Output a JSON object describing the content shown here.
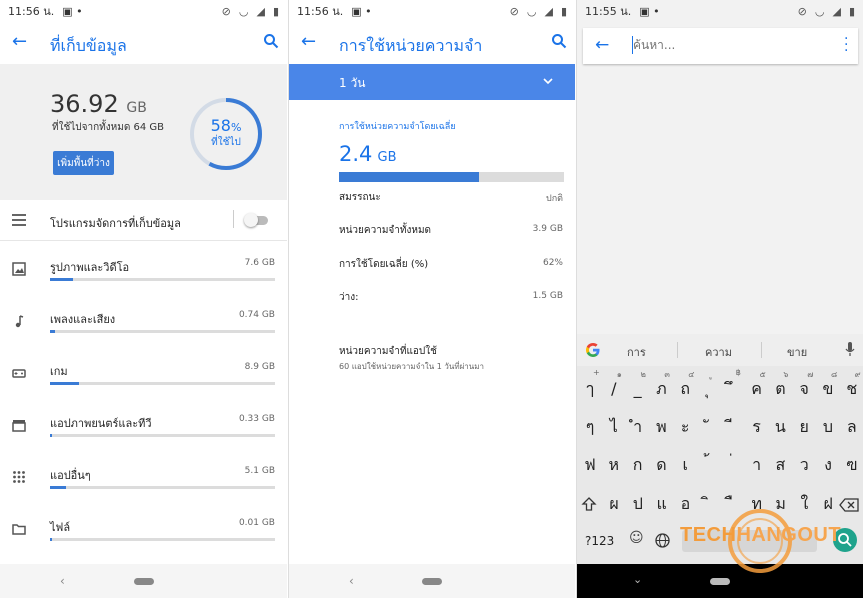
{
  "status_bar": {
    "p1_time": "11:56 น.",
    "p2_time": "11:56 น.",
    "p3_time": "11:55 น."
  },
  "storage": {
    "title": "ที่เก็บข้อมูล",
    "used_value": "36.92",
    "used_unit": "GB",
    "used_subtitle": "ที่ใช้ไปจากทั้งหมด 64 GB",
    "free_button": "เพิ่มพื้นที่ว่าง",
    "percent_number": "58",
    "percent_sign": "%",
    "percent_label": "ที่ใช้ไป",
    "percent_value": 58,
    "manager_label": "โปรแกรมจัดการที่เก็บข้อมูล",
    "manager_enabled": false,
    "categories": [
      {
        "label": "รูปภาพและวิดีโอ",
        "size": "7.6 GB",
        "fraction": 0.1,
        "icon": "image-icon"
      },
      {
        "label": "เพลงและเสียง",
        "size": "0.74 GB",
        "fraction": 0.02,
        "icon": "music-note-icon"
      },
      {
        "label": "เกม",
        "size": "8.9 GB",
        "fraction": 0.13,
        "icon": "gamepad-icon"
      },
      {
        "label": "แอปภาพยนตร์และทีวี",
        "size": "0.33 GB",
        "fraction": 0.01,
        "icon": "clapperboard-icon"
      },
      {
        "label": "แอปอื่นๆ",
        "size": "5.1 GB",
        "fraction": 0.07,
        "icon": "apps-grid-icon"
      },
      {
        "label": "ไฟล์",
        "size": "0.01 GB",
        "fraction": 0.005,
        "icon": "folder-icon"
      }
    ]
  },
  "memory": {
    "title": "การใช้หน่วยความจำ",
    "period": "1 วัน",
    "avg_heading": "การใช้หน่วยความจำโดยเฉลี่ย",
    "avg_value": "2.4",
    "avg_unit": "GB",
    "usage_fraction": 0.62,
    "rows": [
      {
        "label": "สมรรถนะ",
        "value": "ปกติ"
      },
      {
        "label": "หน่วยความจำทั้งหมด",
        "value": "3.9 GB"
      },
      {
        "label": "การใช้โดยเฉลี่ย (%)",
        "value": "62%"
      },
      {
        "label": "ว่าง:",
        "value": "1.5 GB"
      }
    ],
    "apps_title": "หน่วยความจำที่แอปใช้",
    "apps_subtitle": "60 แอปใช้หน่วยความจำใน 1 วันที่ผ่านมา"
  },
  "search_screen": {
    "placeholder": "ค้นหา...",
    "suggestions": [
      "การ",
      "ความ",
      "ขาย"
    ],
    "row1": [
      "ๅ",
      "/",
      "_",
      "ภ",
      "ถ",
      "ุ",
      "ึ",
      "ค",
      "ต",
      "จ",
      "ข",
      "ช"
    ],
    "row1_hints": [
      "+",
      "๑",
      "๒",
      "๓",
      "๔",
      "ู",
      "฿",
      "๕",
      "๖",
      "๗",
      "๘",
      "๙"
    ],
    "row2": [
      "ๆ",
      "ไ",
      "ำ",
      "พ",
      "ะ",
      "ั",
      "ี",
      "ร",
      "น",
      "ย",
      "บ",
      "ล"
    ],
    "row3": [
      "ฟ",
      "ห",
      "ก",
      "ด",
      "เ",
      "้",
      "่",
      "า",
      "ส",
      "ว",
      "ง",
      "ฃ"
    ],
    "row4": [
      "ผ",
      "ป",
      "แ",
      "อ",
      "ิ",
      "ื",
      "ท",
      "ม",
      "ใ",
      "ฝ"
    ],
    "symbols_key": "?123",
    "watermark_left": "TECH",
    "watermark_right": "HANGOUT"
  }
}
